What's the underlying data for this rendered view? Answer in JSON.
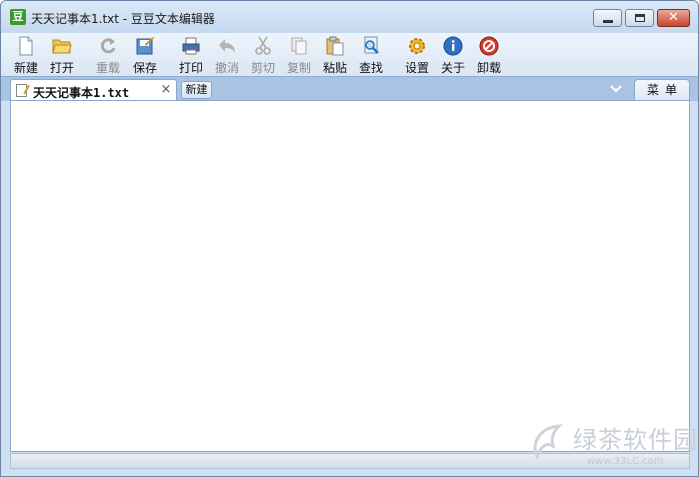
{
  "window": {
    "title": "天天记事本1.txt - 豆豆文本编辑器",
    "app_icon_glyph": "豆",
    "controls": {
      "minimize": "minimize-icon",
      "maximize": "maximize-icon",
      "close_glyph": "✕"
    }
  },
  "toolbar": {
    "items": [
      {
        "label": "新建",
        "icon": "new-file-icon",
        "enabled": true
      },
      {
        "label": "打开",
        "icon": "folder-open-icon",
        "enabled": true,
        "dropdown": true
      },
      {
        "label": "重载",
        "icon": "reload-icon",
        "enabled": false
      },
      {
        "label": "保存",
        "icon": "save-icon",
        "enabled": true,
        "dropdown": true
      },
      {
        "label": "打印",
        "icon": "printer-icon",
        "enabled": true
      },
      {
        "label": "撤消",
        "icon": "undo-icon",
        "enabled": false
      },
      {
        "label": "剪切",
        "icon": "scissors-icon",
        "enabled": false
      },
      {
        "label": "复制",
        "icon": "copy-icon",
        "enabled": false
      },
      {
        "label": "粘贴",
        "icon": "paste-icon",
        "enabled": true
      },
      {
        "label": "查找",
        "icon": "search-icon",
        "enabled": true,
        "dropdown": true
      },
      {
        "label": "设置",
        "icon": "gear-icon",
        "enabled": true
      },
      {
        "label": "关于",
        "icon": "info-icon",
        "enabled": true
      },
      {
        "label": "卸载",
        "icon": "uninstall-icon",
        "enabled": true
      }
    ]
  },
  "tabs": {
    "active_label": "天天记事本1.txt",
    "close_glyph": "×",
    "new_tab_label": "新建",
    "menu_label": "菜单"
  },
  "editor": {
    "content": ""
  },
  "watermark": {
    "text": "绿茶软件园",
    "url": "www.33LC.com"
  },
  "colors": {
    "close_red": "#c9442d",
    "accent_blue": "#a9c4e2",
    "brand_green": "#3a9a2a"
  }
}
